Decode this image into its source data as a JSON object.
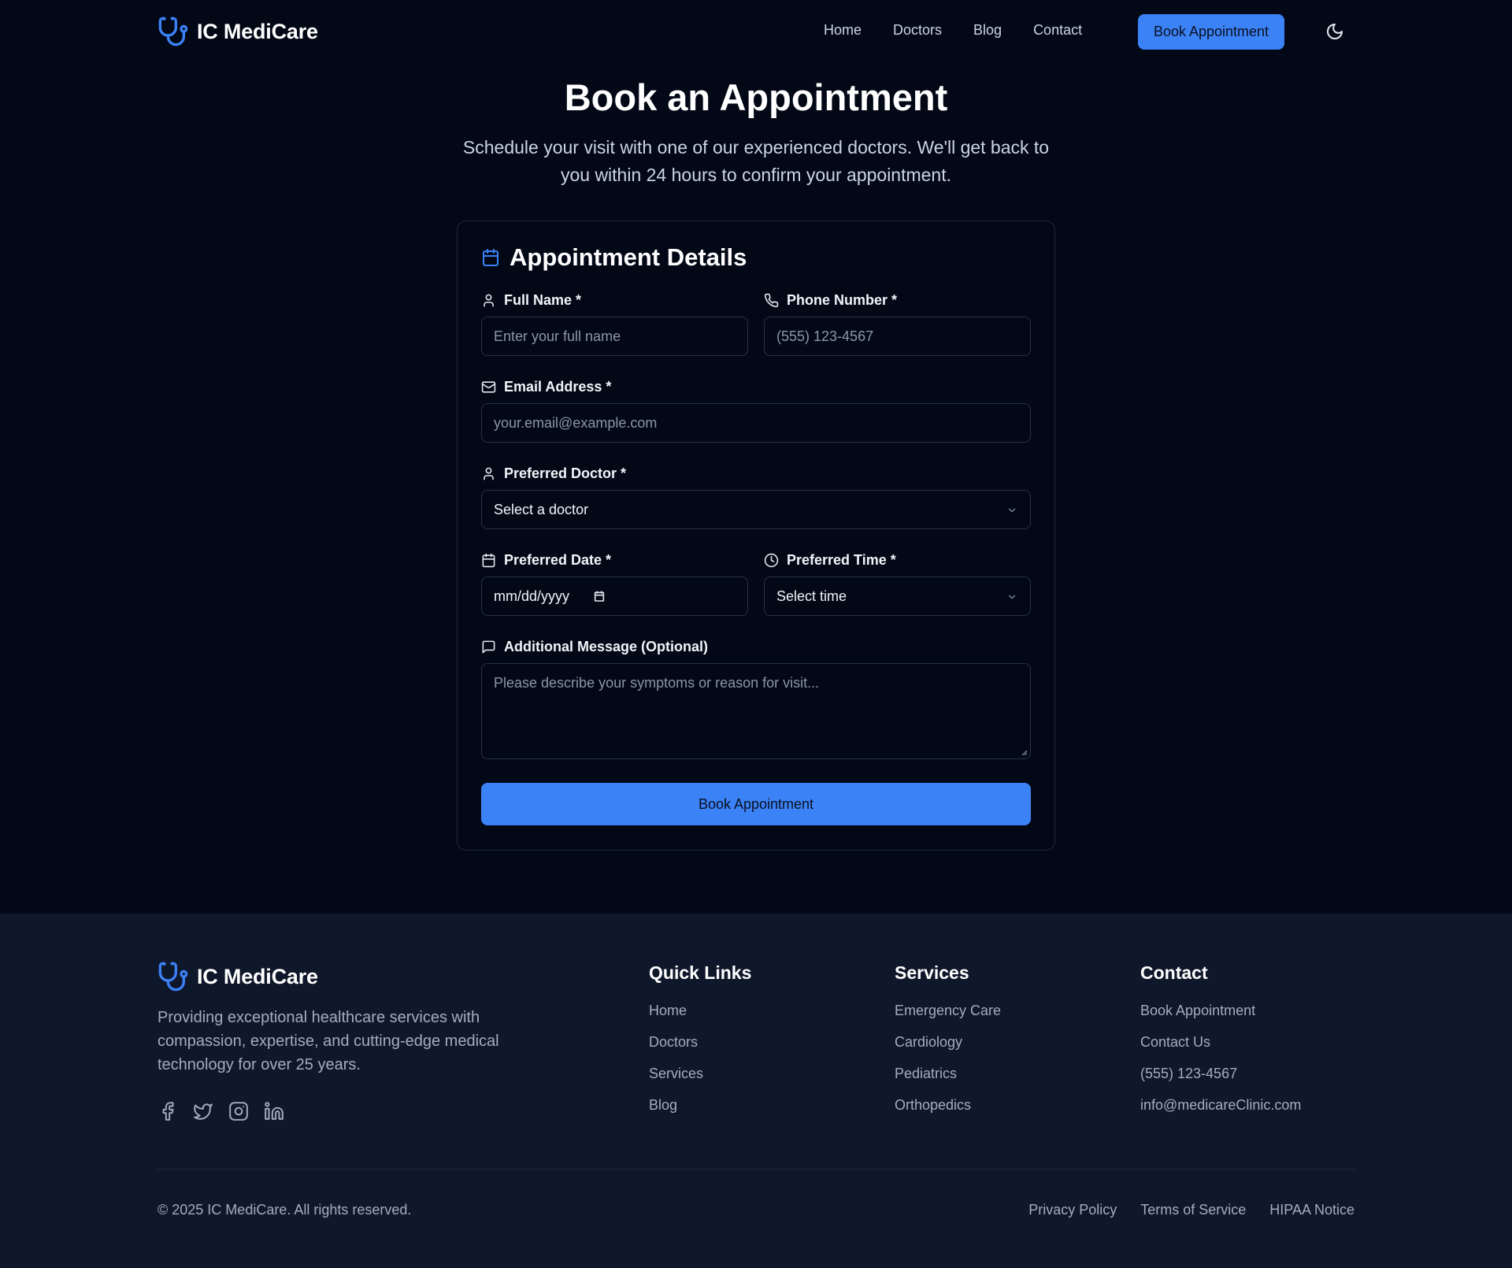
{
  "brand": {
    "name": "IC MediCare",
    "accent": "#3b82f6"
  },
  "nav": {
    "links": [
      "Home",
      "Doctors",
      "Blog",
      "Contact"
    ],
    "cta": "Book Appointment",
    "theme_icon": "moon-icon"
  },
  "hero": {
    "title": "Book an Appointment",
    "subtitle": "Schedule your visit with one of our experienced doctors. We'll get back to you within 24 hours to confirm your appointment."
  },
  "form": {
    "title": "Appointment Details",
    "full_name": {
      "label": "Full Name *",
      "placeholder": "Enter your full name"
    },
    "phone": {
      "label": "Phone Number *",
      "placeholder": "(555) 123-4567"
    },
    "email": {
      "label": "Email Address *",
      "placeholder": "your.email@example.com"
    },
    "doctor": {
      "label": "Preferred Doctor *",
      "value": "Select a doctor"
    },
    "date": {
      "label": "Preferred Date *",
      "value": "mm/dd/yyyy"
    },
    "time": {
      "label": "Preferred Time *",
      "value": "Select time"
    },
    "message": {
      "label": "Additional Message (Optional)",
      "placeholder": "Please describe your symptoms or reason for visit..."
    },
    "submit": "Book Appointment"
  },
  "footer": {
    "brand": "IC MediCare",
    "description": "Providing exceptional healthcare services with compassion, expertise, and cutting-edge medical technology for over 25 years.",
    "socials": [
      "facebook-icon",
      "twitter-icon",
      "instagram-icon",
      "linkedin-icon"
    ],
    "quick_links": {
      "title": "Quick Links",
      "items": [
        "Home",
        "Doctors",
        "Services",
        "Blog"
      ]
    },
    "services": {
      "title": "Services",
      "items": [
        "Emergency Care",
        "Cardiology",
        "Pediatrics",
        "Orthopedics"
      ]
    },
    "contact": {
      "title": "Contact",
      "items": [
        "Book Appointment",
        "Contact Us",
        "(555) 123-4567",
        "info@medicareClinic.com"
      ]
    },
    "copyright": "© 2025 IC MediCare. All rights reserved.",
    "legal": [
      "Privacy Policy",
      "Terms of Service",
      "HIPAA Notice"
    ]
  }
}
